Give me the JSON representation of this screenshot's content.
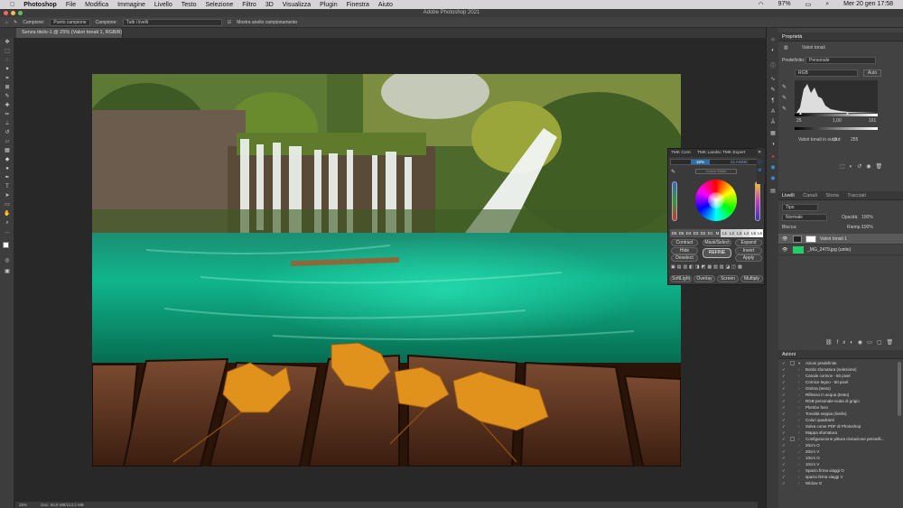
{
  "menubar": {
    "app": "Photoshop",
    "items": [
      "File",
      "Modifica",
      "Immagine",
      "Livello",
      "Testo",
      "Selezione",
      "Filtro",
      "3D",
      "Visualizza",
      "Plugin",
      "Finestra",
      "Aiuto"
    ],
    "battery": "97%",
    "clock": "Mer 20 gen 17:58"
  },
  "window": {
    "title": "Adobe Photoshop 2021"
  },
  "options": {
    "sample_label": "Campione:",
    "sample_value": "Punto campione",
    "sample2_label": "Campione:",
    "sample2_value": "Tutti i livelli",
    "ring_label": "Mostra anello campionamento"
  },
  "document": {
    "tab": "Senza titolo-1 @ 25% (Valori tonali 1, RGB/8) *"
  },
  "status": {
    "zoom": "25%",
    "doc": "Doc: 84,9 MB/113,2 MB"
  },
  "properties": {
    "title": "Proprietà",
    "adj_name": "Valori tonali",
    "preset_label": "Predefinito:",
    "preset_value": "Personale",
    "channel": "RGB",
    "auto": "Auto",
    "input_min": "25",
    "input_mid": "1,00",
    "input_max": "161",
    "output_label": "Valori tonali in output:",
    "output_min": "0",
    "output_max": "255"
  },
  "tmk": {
    "tabs": [
      "TMK Core",
      "TMK Landsc",
      "TMK Expert"
    ],
    "mode_left": "16%",
    "mode_right": "CLASSIC",
    "color_mode": "Colour Mode",
    "zones": [
      "D6",
      "D5",
      "D4",
      "D3",
      "D2",
      "D1",
      "M",
      "L1",
      "L2",
      "L3",
      "L4",
      "L5",
      "L6"
    ],
    "buttons": {
      "contract": "Contract",
      "mask": "Mask/Select",
      "expand": "Expand",
      "hide": "Hide",
      "invert": "Invert",
      "deselect": "Deselect",
      "refine": "REFINE",
      "apply": "Apply",
      "softlight": "SoftLight",
      "overlay": "Overlay",
      "screen": "Screen",
      "multiply": "Multiply"
    }
  },
  "layers": {
    "tabs": [
      "Livelli",
      "Canali",
      "Storia",
      "Tracciati"
    ],
    "kind": "Tipo",
    "blend": "Normale",
    "opacity_label": "Opacità:",
    "opacity": "100%",
    "lock_label": "Blocca:",
    "fill_label": "Riemp.:",
    "fill": "100%",
    "items": [
      {
        "name": "Valori tonali 1"
      },
      {
        "name": "_MG_2479.jpg (unito)"
      }
    ]
  },
  "actions": {
    "title": "Azioni",
    "items": [
      "Azioni predefinite",
      "Bordo sfumatura (selezione)",
      "Canale cornice - 50 pixel",
      "Cornice legno - 50 pixel",
      "Ombra (testo)",
      "Riflesso in acqua (testo)",
      "RGB personale-scala di grigio",
      "Plombo fuso",
      "Tonalità seppia (livello)",
      "Colori quadranti",
      "Salva come PDF di Photoshop",
      "Mappa sfumatura",
      "Configurazione pittura clonazione pennelli...",
      "20cm O",
      "20cm V",
      "10cm O",
      "10cm V",
      "Spazio firma viaggi O",
      "spazio firma viaggi V",
      "Widow O"
    ]
  },
  "colors": {
    "ui_bg": "#424242",
    "canvas_bg": "#282828",
    "water": "#0fae86",
    "leaf": "#e3951e",
    "wood": "#6b3a22"
  }
}
